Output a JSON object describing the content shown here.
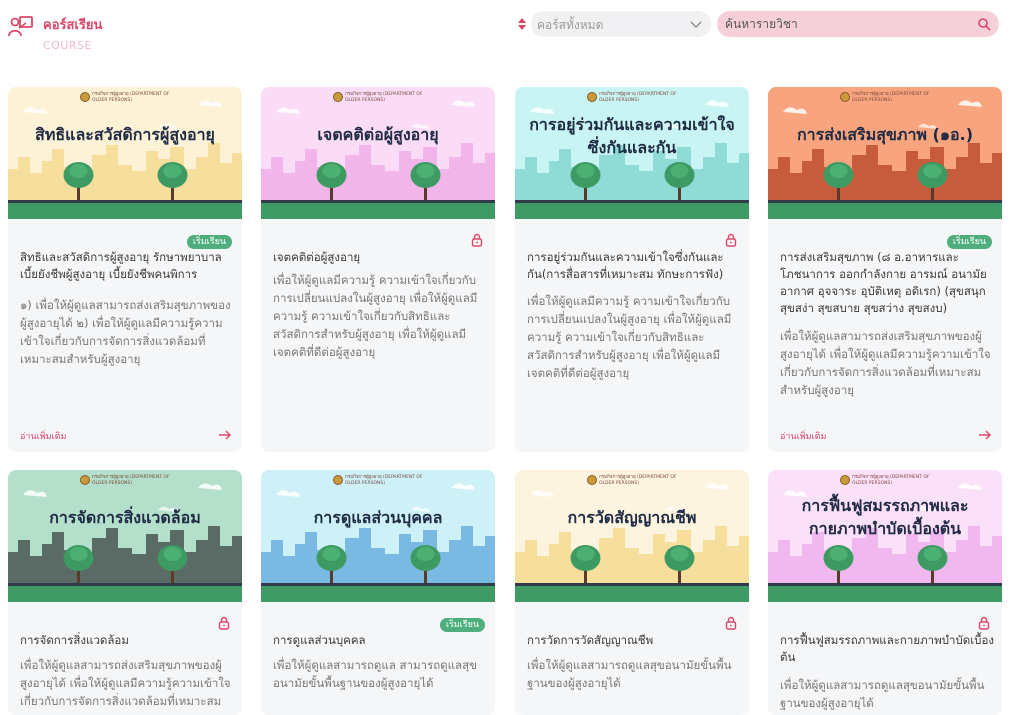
{
  "header": {
    "title": "คอร์สเรียน",
    "subtitle": "COURSE",
    "filter_value": "คอร์สทั้งหมด",
    "search_placeholder": "ค้นหารายวิชา"
  },
  "seal_text": "กรมกิจการผู้สูงอายุ (DEPARTMENT OF OLDER PERSONS)",
  "cards": [
    {
      "banner_title": "สิทธิและสวัสดิการผู้สูงอายุ",
      "status": "เริ่มเรียน",
      "title": "สิทธิและสวัสดิการผู้สูงอายุ รักษาพยาบาล เบี้ยยังชีพผู้สูงอายุ เบี้ยยังชีพคนพิการ",
      "description": "๑) เพื่อให้ผู้ดูแลสามารถส่งเสริมสุขภาพของผู้สูงอายุได้ ๒) เพื่อให้ผู้ดูแลมีความรู้ความเข้าใจเกี่ยวกับการจัดการสิ่งแวดล้อมที่เหมาะสมสำหรับผู้สูงอายุ",
      "read_more": "อ่านเพิ่มเติม"
    },
    {
      "banner_title": "เจตคติต่อผู้สูงอายุ",
      "status": "",
      "title": "เจตคติต่อผู้สูงอายุ",
      "description": "เพื่อให้ผู้ดูแลมีความรู้ ความเข้าใจเกี่ยวกับการเปลี่ยนแปลงในผู้สูงอายุ เพื่อให้ผู้ดูแลมีความรู้ ความเข้าใจเกี่ยวกับสิทธิและสวัสดิการสำหรับผู้สูงอายุ เพื่อให้ผู้ดูแลมีเจตคติที่ดีต่อผู้สูงอายุ",
      "read_more": ""
    },
    {
      "banner_title": "การอยู่ร่วมกันและความเข้าใจซึ่งกันและกัน",
      "status": "",
      "title": "การอยู่ร่วมกันและความเข้าใจซึ่งกันและกัน(การสื่อสารที่เหมาะสม ทักษะการฟัง)",
      "description": "เพื่อให้ผู้ดูแลมีความรู้ ความเข้าใจเกี่ยวกับการเปลี่ยนแปลงในผู้สูงอายุ เพื่อให้ผู้ดูแลมีความรู้ ความเข้าใจเกี่ยวกับสิทธิและสวัสดิการสำหรับผู้สูงอายุ เพื่อให้ผู้ดูแลมีเจตคติที่ดีต่อผู้สูงอายุ",
      "read_more": ""
    },
    {
      "banner_title": "การส่งเสริมสุขภาพ (๑อ.)",
      "status": "เริ่มเรียน",
      "title": "การส่งเสริมสุขภาพ (๘ อ.อาหารและโภชนาการ ออกกำลังกาย อารมณ์ อนามัย อากาศ อุจจาระ อุบัติเหตุ อดิเรก) (สุขสนุก สุขสง่า สุขสบาย สุขสว่าง สุขสงบ)",
      "description": "เพื่อให้ผู้ดูแลสามารถส่งเสริมสุขภาพของผู้สูงอายุได้ เพื่อให้ผู้ดูแลมีความรู้ความเข้าใจเกี่ยวกับการจัดการสิ่งแวดล้อมที่เหมาะสมสำหรับผู้สูงอายุ",
      "read_more": "อ่านเพิ่มเติม"
    },
    {
      "banner_title": "การจัดการสิ่งแวดล้อม",
      "status": "",
      "title": "การจัดการสิ่งแวดล้อม",
      "description": "เพื่อให้ผู้ดูแลสามารถส่งเสริมสุขภาพของผู้สูงอายุได้ เพื่อให้ผู้ดูแลมีความรู้ความเข้าใจเกี่ยวกับการจัดการสิ่งแวดล้อมที่เหมาะสม",
      "read_more": ""
    },
    {
      "banner_title": "การดูแลส่วนบุคคล",
      "status": "เริ่มเรียน",
      "title": "การดูแลส่วนบุคคล",
      "description": "เพื่อให้ผู้ดูแลสามารถดูแล สามารถดูแลสุขอนามัยขั้นพื้นฐานของผู้สูงอายุได้",
      "read_more": ""
    },
    {
      "banner_title": "การวัดสัญญาณชีพ",
      "status": "",
      "title": "การวัดการวัดสัญญาณชีพ",
      "description": "เพื่อให้ผู้ดูแลสามารถดูแลสุขอนามัยขั้นพื้นฐานของผู้สูงอายุได้",
      "read_more": ""
    },
    {
      "banner_title": "การฟื้นฟูสมรรถภาพและกายภาพบำบัดเบื้องต้น",
      "status": "",
      "title": "การฟื้นฟูสมรรถภาพและกายภาพบำบัดเบื้องต้น",
      "description": "เพื่อให้ผู้ดูแลสามารถดูแลสุขอนามัยขั้นพื้นฐานของผู้สูงอายุได้",
      "read_more": ""
    }
  ],
  "colors": {
    "accent": "#d9486a",
    "tag_green": "#4fae7d",
    "grass": "#3f9a66"
  }
}
